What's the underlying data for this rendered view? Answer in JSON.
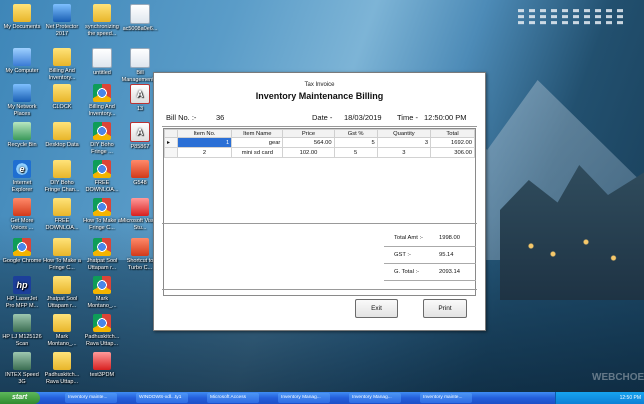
{
  "desktop_icons": [
    {
      "label": "My Documents",
      "icon": "documents-folder-icon"
    },
    {
      "label": "Net Protector 2017",
      "icon": "net-protector-icon"
    },
    {
      "label": "synchronizing the speed...",
      "icon": "folder-icon"
    },
    {
      "label": "ac5008a0e6...",
      "icon": "document-file-icon"
    },
    {
      "label": "My Computer",
      "icon": "my-computer-icon"
    },
    {
      "label": "Billing And Inventory...",
      "icon": "folder-icon"
    },
    {
      "label": "untitled",
      "icon": "folder-icon"
    },
    {
      "label": "Bill Management...",
      "icon": "document-file-icon"
    },
    {
      "label": "My Network Places",
      "icon": "network-places-icon"
    },
    {
      "label": "CLOCK",
      "icon": "folder-icon"
    },
    {
      "label": "Billing And Inventory...",
      "icon": "chrome-icon"
    },
    {
      "label": "13",
      "icon": "pdf-icon"
    },
    {
      "label": "Recycle Bin",
      "icon": "recycle-bin-icon"
    },
    {
      "label": "Desktop Data",
      "icon": "folder-icon"
    },
    {
      "label": "DIY Boho Fringe ...",
      "icon": "chrome-icon"
    },
    {
      "label": "P85867",
      "icon": "pdf-icon"
    },
    {
      "label": "Internet Explorer",
      "icon": "internet-explorer-icon"
    },
    {
      "label": "DIY Boho Fringe Chan...",
      "icon": "folder-icon"
    },
    {
      "label": "FREE DOWNLOA...",
      "icon": "chrome-icon"
    },
    {
      "label": "G548",
      "icon": "video-file-icon"
    },
    {
      "label": "Get More Voices ...",
      "icon": "get-voices-icon"
    },
    {
      "label": "FREE DOWNLOA...",
      "icon": "folder-icon"
    },
    {
      "label": "How To Make a Fringe C...",
      "icon": "chrome-icon"
    },
    {
      "label": "Microsoft Visual Stu...",
      "icon": "visual-studio-icon"
    },
    {
      "label": "Google Chrome",
      "icon": "chrome-icon"
    },
    {
      "label": "How To Make a Fringe C...",
      "icon": "folder-icon"
    },
    {
      "label": "Jhatpat Sool Uttapam r...",
      "icon": "chrome-icon"
    },
    {
      "label": "Shortcut to Turbo C...",
      "icon": "turbo-c-icon"
    },
    {
      "label": "HP LaserJet Pro MFP M...",
      "icon": "hp-icon"
    },
    {
      "label": "Jhatpat Sool Uttapam r...",
      "icon": "folder-icon"
    },
    {
      "label": "Mark Montano_...",
      "icon": "chrome-icon"
    },
    {
      "label": "HP LJ M125126 Scan",
      "icon": "hp-scan-icon"
    },
    {
      "label": "Mark Montano_...",
      "icon": "folder-icon"
    },
    {
      "label": "Padhuskitch... Rava Uttap...",
      "icon": "chrome-icon"
    },
    {
      "label": "INTEX Speed 3G",
      "icon": "intex-speed-icon"
    },
    {
      "label": "Padhuskitch... Rava Uttap...",
      "icon": "folder-icon"
    },
    {
      "label": "test3PDM",
      "icon": "test-app-icon"
    }
  ],
  "window": {
    "subtitle": "Tax Invoice",
    "title": "Inventory Maintenance  Billing",
    "bill_no_label": "Bill No. :-",
    "bill_no": "36",
    "date_label": "Date  -",
    "date": "18/03/2019",
    "time_label": "Time  -",
    "time": "12:50:00 PM",
    "grid": {
      "columns": [
        "Item No.",
        "Item Name",
        "Price",
        "Gst %",
        "Quantity",
        "Total"
      ],
      "rows": [
        {
          "marker": "▸",
          "item_no": "1",
          "item_name": "gear",
          "price": "564.00",
          "gst": "5",
          "quantity": "3",
          "total": "1692.00"
        },
        {
          "marker": "",
          "item_no": "2",
          "item_name": "mini sd card",
          "price": "102.00",
          "gst": "5",
          "quantity": "3",
          "total": "306.00"
        }
      ]
    },
    "totals": {
      "total_amt_label": "Total Amt :-",
      "total_amt": "1998.00",
      "gst_label": "GST :-",
      "gst": "95.14",
      "grand_total_label": "G. Total :-",
      "grand_total": "2093.14"
    },
    "buttons": {
      "exit": "Exit",
      "print": "Print"
    }
  },
  "taskbar": {
    "start_label": "start",
    "items": [
      "Inventory mainte...",
      "WINDOWS-xdl...ty1",
      "Microsoft Access",
      "Inventory Manag...",
      "Inventory Manag...",
      "Inventory mainte..."
    ],
    "clock": "12:50 PM"
  },
  "watermark": "WEBCHOE"
}
